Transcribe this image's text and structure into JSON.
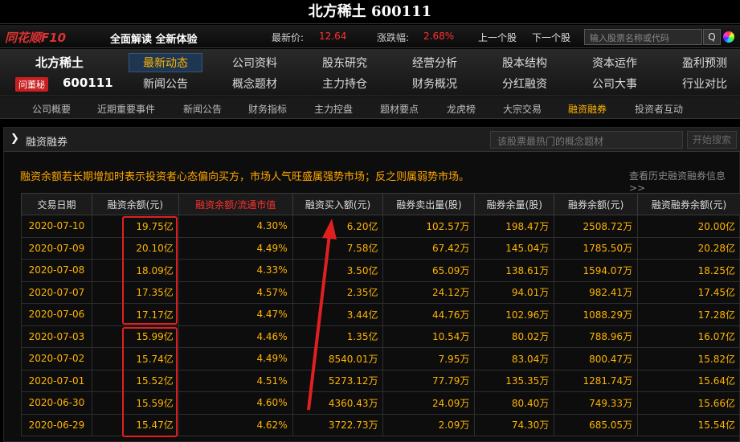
{
  "window_title": "北方稀土 600111",
  "brand": {
    "logo": "同花顺F10",
    "slogan": "全面解读 全新体验"
  },
  "quote": {
    "price_label": "最新价:",
    "price": "12.64",
    "change_label": "涨跌幅:",
    "change": "2.68%"
  },
  "nav_prev": "上一个股",
  "nav_next": "下一个股",
  "search": {
    "placeholder": "输入股票名称或代码",
    "button": "Q"
  },
  "stock": {
    "name": "北方稀土",
    "badge": "问董秘",
    "code": "600111"
  },
  "menu": {
    "row1": [
      "最新动态",
      "公司资料",
      "股东研究",
      "经营分析",
      "股本结构",
      "资本运作",
      "盈利预测"
    ],
    "row2": [
      "新闻公告",
      "概念题材",
      "主力持仓",
      "财务概况",
      "分红融资",
      "公司大事",
      "行业对比"
    ],
    "active": "最新动态"
  },
  "subnav": [
    "公司概要",
    "近期重要事件",
    "新闻公告",
    "财务指标",
    "主力控盘",
    "题材要点",
    "龙虎榜",
    "大宗交易",
    "融资融券",
    "投资者互动"
  ],
  "subnav_active": "融资融券",
  "panel": {
    "title": "融资融券",
    "concept_search_placeholder": "该股票最热门的概念题材",
    "start_search": "开始搜索",
    "notice": "融资余额若长期增加时表示投资者心态偏向买方，市场人气旺盛属强势市场；反之则属弱势市场。",
    "history_link": "查看历史融资融券信息>>"
  },
  "table": {
    "headers": [
      "交易日期",
      "融资余额(元)",
      "融资余额/流通市值",
      "融资买入额(元)",
      "融券卖出量(股)",
      "融券余量(股)",
      "融券余额(元)",
      "融资融券余额(元)"
    ],
    "rows": [
      [
        "2020-07-10",
        "19.75亿",
        "4.30%",
        "6.20亿",
        "102.57万",
        "198.47万",
        "2508.72万",
        "20.00亿"
      ],
      [
        "2020-07-09",
        "20.10亿",
        "4.49%",
        "7.58亿",
        "67.42万",
        "145.04万",
        "1785.50万",
        "20.28亿"
      ],
      [
        "2020-07-08",
        "18.09亿",
        "4.33%",
        "3.50亿",
        "65.09万",
        "138.61万",
        "1594.07万",
        "18.25亿"
      ],
      [
        "2020-07-07",
        "17.35亿",
        "4.57%",
        "2.35亿",
        "24.12万",
        "94.01万",
        "982.41万",
        "17.45亿"
      ],
      [
        "2020-07-06",
        "17.17亿",
        "4.47%",
        "3.44亿",
        "44.76万",
        "102.96万",
        "1088.29万",
        "17.28亿"
      ],
      [
        "2020-07-03",
        "15.99亿",
        "4.46%",
        "1.35亿",
        "10.54万",
        "80.02万",
        "788.96万",
        "16.07亿"
      ],
      [
        "2020-07-02",
        "15.74亿",
        "4.49%",
        "8540.01万",
        "7.95万",
        "83.04万",
        "800.47万",
        "15.82亿"
      ],
      [
        "2020-07-01",
        "15.52亿",
        "4.51%",
        "5273.12万",
        "77.79万",
        "135.35万",
        "1281.74万",
        "15.64亿"
      ],
      [
        "2020-06-30",
        "15.59亿",
        "4.60%",
        "4360.43万",
        "24.09万",
        "80.40万",
        "749.33万",
        "15.66亿"
      ],
      [
        "2020-06-29",
        "15.47亿",
        "4.62%",
        "3722.73万",
        "2.09万",
        "74.30万",
        "685.05万",
        "15.54亿"
      ]
    ]
  },
  "colors": {
    "accent": "#ffb400",
    "highlight_red": "#ff3030",
    "annotation": "#e02020",
    "active_tab_bg": "#1e3652"
  }
}
